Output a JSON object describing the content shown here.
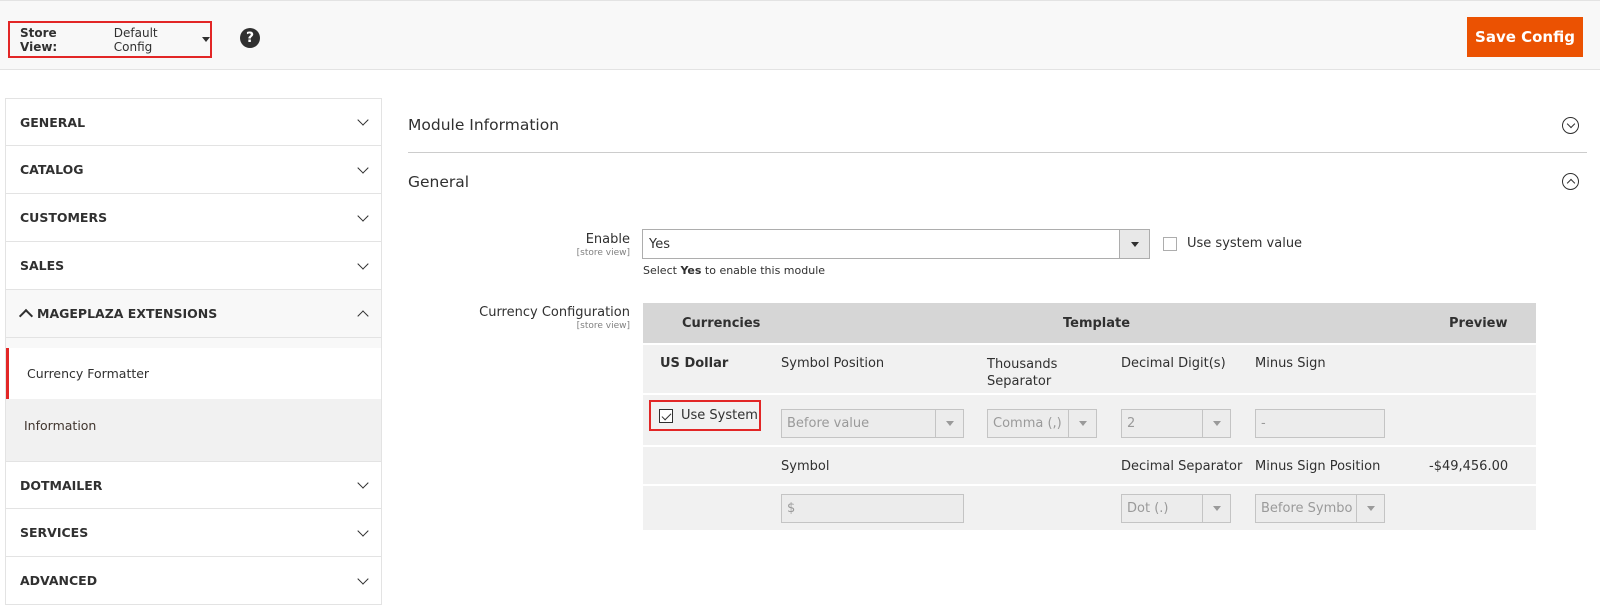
{
  "header": {
    "store_view_label": "Store View:",
    "store_view_value": "Default Config",
    "help_symbol": "?",
    "save_label": "Save Config"
  },
  "sidebar": {
    "items": [
      {
        "label": "GENERAL"
      },
      {
        "label": "CATALOG"
      },
      {
        "label": "CUSTOMERS"
      },
      {
        "label": "SALES"
      },
      {
        "label": "MAGEPLAZA EXTENSIONS"
      },
      {
        "label": "DOTMAILER"
      },
      {
        "label": "SERVICES"
      },
      {
        "label": "ADVANCED"
      }
    ],
    "sub_items": [
      {
        "label": "Currency Formatter"
      },
      {
        "label": "Information"
      }
    ]
  },
  "main": {
    "section_module_info": "Module Information",
    "section_general": "General",
    "enable": {
      "label": "Enable",
      "scope": "[store view]",
      "value": "Yes",
      "use_system_label": "Use system value",
      "note_prefix": "Select ",
      "note_bold": "Yes",
      "note_suffix": " to enable this module"
    },
    "currency_config": {
      "label": "Currency Configuration",
      "scope": "[store view]",
      "headers": {
        "currencies": "Currencies",
        "template": "Template",
        "preview": "Preview"
      },
      "currency_name": "US Dollar",
      "use_system_label": "Use System",
      "col_symbol_position": "Symbol Position",
      "col_thousands_separator_1": "Thousands",
      "col_thousands_separator_2": "Separator",
      "col_decimal_digits": "Decimal Digit(s)",
      "col_minus_sign": "Minus Sign",
      "symbol_position_value": "Before value",
      "thousands_separator_value": "Comma (,)",
      "decimal_digits_value": "2",
      "minus_sign_value": "-",
      "col_symbol": "Symbol",
      "col_decimal_separator": "Decimal Separator",
      "col_minus_sign_position": "Minus Sign Position",
      "preview_value": "-$49,456.00",
      "symbol_value": "$",
      "decimal_separator_value": "Dot (.)",
      "minus_sign_position_value": "Before Symbo"
    }
  }
}
